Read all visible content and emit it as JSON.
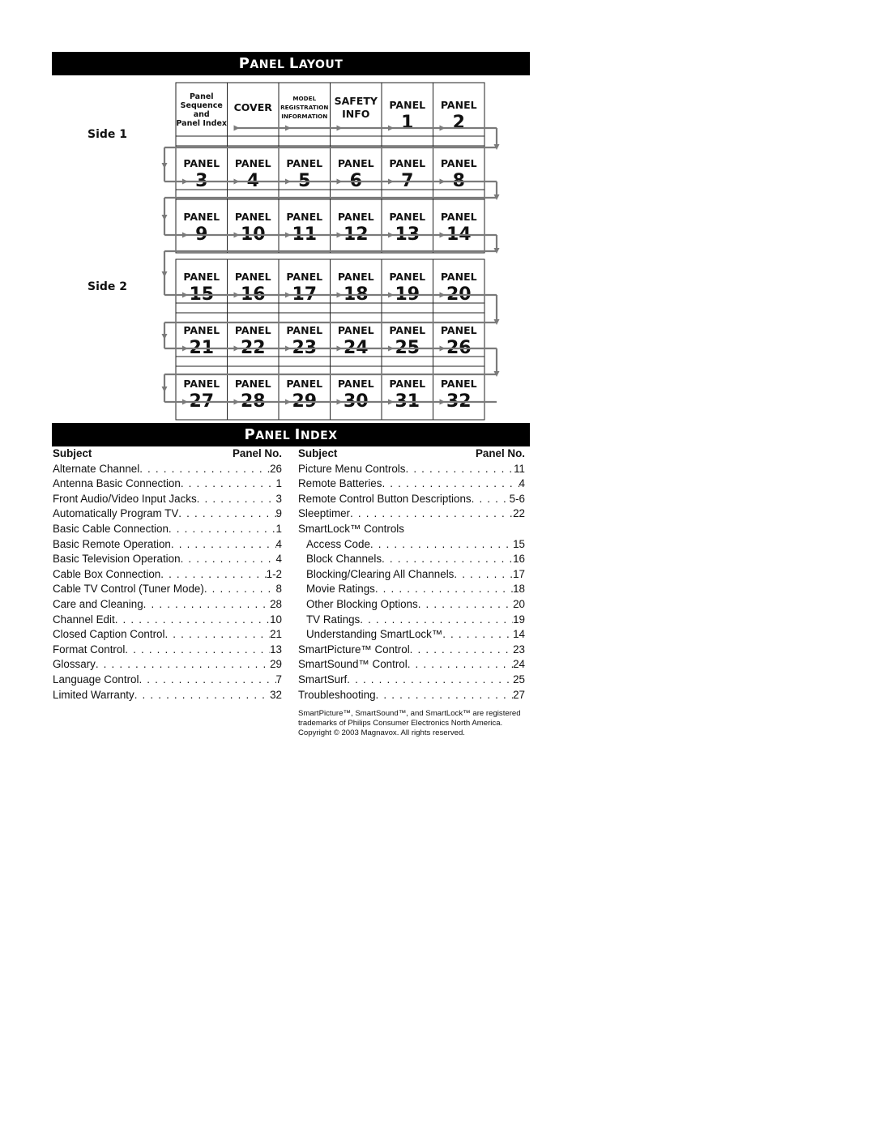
{
  "layout": {
    "title_first": "P",
    "title_rest": "ANEL ",
    "title_first2": "L",
    "title_rest2": "AYOUT",
    "side1_label": "Side 1",
    "side2_label": "Side 2",
    "panel_word": "PANEL",
    "side1_rows": [
      [
        {
          "type": "sequence",
          "lines": [
            "Panel",
            "Sequence",
            "and",
            "Panel Index"
          ]
        },
        {
          "type": "cover",
          "lines": [
            "COVER"
          ]
        },
        {
          "type": "model",
          "lines": [
            "MODEL",
            "REGISTRATION",
            "INFORMATION"
          ]
        },
        {
          "type": "safety",
          "lines": [
            "SAFETY",
            "INFO"
          ]
        },
        {
          "type": "panel",
          "number": "1"
        },
        {
          "type": "panel",
          "number": "2"
        }
      ],
      [
        {
          "type": "panel",
          "number": "3"
        },
        {
          "type": "panel",
          "number": "4"
        },
        {
          "type": "panel",
          "number": "5"
        },
        {
          "type": "panel",
          "number": "6"
        },
        {
          "type": "panel",
          "number": "7"
        },
        {
          "type": "panel",
          "number": "8"
        }
      ],
      [
        {
          "type": "panel",
          "number": "9"
        },
        {
          "type": "panel",
          "number": "10"
        },
        {
          "type": "panel",
          "number": "11"
        },
        {
          "type": "panel",
          "number": "12"
        },
        {
          "type": "panel",
          "number": "13"
        },
        {
          "type": "panel",
          "number": "14"
        }
      ]
    ],
    "side2_rows": [
      [
        {
          "type": "panel",
          "number": "15"
        },
        {
          "type": "panel",
          "number": "16"
        },
        {
          "type": "panel",
          "number": "17"
        },
        {
          "type": "panel",
          "number": "18"
        },
        {
          "type": "panel",
          "number": "19"
        },
        {
          "type": "panel",
          "number": "20"
        }
      ],
      [
        {
          "type": "panel",
          "number": "21"
        },
        {
          "type": "panel",
          "number": "22"
        },
        {
          "type": "panel",
          "number": "23"
        },
        {
          "type": "panel",
          "number": "24"
        },
        {
          "type": "panel",
          "number": "25"
        },
        {
          "type": "panel",
          "number": "26"
        }
      ],
      [
        {
          "type": "panel",
          "number": "27"
        },
        {
          "type": "panel",
          "number": "28"
        },
        {
          "type": "panel",
          "number": "29"
        },
        {
          "type": "panel",
          "number": "30"
        },
        {
          "type": "panel",
          "number": "31"
        },
        {
          "type": "panel",
          "number": "32"
        }
      ]
    ],
    "line_color": "#7a7a7a",
    "grid_color": "#222222"
  },
  "index": {
    "title_first": "P",
    "title_rest": "ANEL ",
    "title_first2": "I",
    "title_rest2": "NDEX",
    "header_subject": "Subject",
    "header_panel": "Panel No.",
    "left": [
      {
        "subject": "Alternate Channel",
        "panel": "26"
      },
      {
        "subject": "Antenna Basic Connection",
        "panel": "1"
      },
      {
        "subject": "Front Audio/Video Input Jacks",
        "panel": "3"
      },
      {
        "subject": "Automatically Program TV",
        "panel": "9"
      },
      {
        "subject": "Basic Cable Connection",
        "panel": "1"
      },
      {
        "subject": "Basic Remote Operation",
        "panel": "4"
      },
      {
        "subject": "Basic Television Operation",
        "panel": "4"
      },
      {
        "subject": "Cable Box Connection",
        "panel": "1-2"
      },
      {
        "subject": "Cable TV Control (Tuner Mode)",
        "panel": "8"
      },
      {
        "subject": "Care and Cleaning",
        "panel": "28"
      },
      {
        "subject": "Channel Edit",
        "panel": "10"
      },
      {
        "subject": "Closed Caption Control",
        "panel": "21"
      },
      {
        "subject": "Format Control",
        "panel": "13"
      },
      {
        "subject": "Glossary",
        "panel": "29"
      },
      {
        "subject": "Language Control",
        "panel": "7"
      },
      {
        "subject": "Limited Warranty",
        "panel": "32"
      }
    ],
    "right": [
      {
        "subject": "Picture Menu Controls",
        "panel": "11",
        "indent": false
      },
      {
        "subject": "Remote Batteries",
        "panel": "4",
        "indent": false
      },
      {
        "subject": "Remote Control Button Descriptions",
        "panel": "5-6",
        "indent": false
      },
      {
        "subject": "Sleeptimer",
        "panel": "22",
        "indent": false
      },
      {
        "subject": "SmartLock™ Controls",
        "panel": "",
        "indent": false
      },
      {
        "subject": "Access Code",
        "panel": "15",
        "indent": true
      },
      {
        "subject": "Block Channels",
        "panel": "16",
        "indent": true
      },
      {
        "subject": "Blocking/Clearing All Channels",
        "panel": "17",
        "indent": true
      },
      {
        "subject": "Movie Ratings",
        "panel": "18",
        "indent": true
      },
      {
        "subject": "Other Blocking Options",
        "panel": "20",
        "indent": true
      },
      {
        "subject": "TV Ratings",
        "panel": "19",
        "indent": true
      },
      {
        "subject": "Understanding SmartLock™",
        "panel": "14",
        "indent": true
      },
      {
        "subject": "SmartPicture™ Control",
        "panel": "23",
        "indent": false
      },
      {
        "subject": "SmartSound™ Control",
        "panel": "24",
        "indent": false
      },
      {
        "subject": "SmartSurf",
        "panel": "25",
        "indent": false
      },
      {
        "subject": "Troubleshooting",
        "panel": "27",
        "indent": false
      }
    ],
    "footnote": "SmartPicture™, SmartSound™, and SmartLock™ are registered trademarks of Philips Consumer Electronics North America. Copyright © 2003 Magnavox. All rights reserved."
  }
}
